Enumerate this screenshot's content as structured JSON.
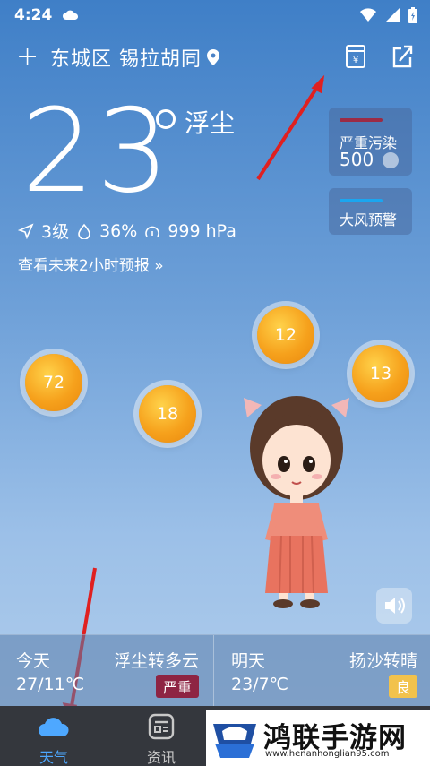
{
  "status": {
    "time": "4:24"
  },
  "header": {
    "location": "东城区 锡拉胡同",
    "icons": [
      "add-icon",
      "location-pin-icon",
      "wallet-icon",
      "share-icon"
    ]
  },
  "current": {
    "temperature": "23",
    "condition": "浮尘",
    "wind_level": "3级",
    "humidity": "36%",
    "pressure": "999 hPa",
    "forecast_link": "查看未来2小时预报 »"
  },
  "alerts": [
    {
      "title": "严重污染",
      "value": "500",
      "color": "#9b2b45"
    },
    {
      "title": "大风预警",
      "color": "#1aa6f0"
    }
  ],
  "bubbles": [
    "72",
    "18",
    "12",
    "13"
  ],
  "forecast": {
    "today": {
      "day": "今天",
      "condition": "浮尘转多云",
      "temp": "27/11℃",
      "badge": "严重"
    },
    "tomorrow": {
      "day": "明天",
      "condition": "扬沙转晴",
      "temp": "23/7℃",
      "badge": "良"
    }
  },
  "nav": [
    {
      "label": "天气",
      "icon": "cloud-icon",
      "active": true
    },
    {
      "label": "资讯",
      "icon": "news-icon",
      "active": false
    }
  ],
  "watermark": {
    "title": "鸿联手游网",
    "url": "www.henanhonglian95.com"
  },
  "colors": {
    "accent": "#4ea8ff",
    "severe": "#8e2443",
    "good": "#f2c24c",
    "nav_bg": "#34373d"
  }
}
